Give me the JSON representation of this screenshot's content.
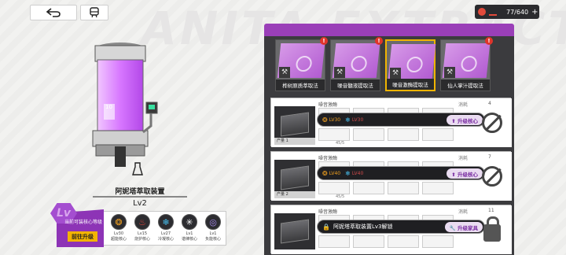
{
  "top_bar": {
    "back_icon": "back-arrow-icon",
    "device_icon": "train-icon",
    "resource_value": "77/640",
    "resource_plus": "+"
  },
  "background": {
    "title": "ANITA EXTRACT"
  },
  "device": {
    "name": "阿妮塔萃取装置",
    "level": "Lv2",
    "badge_text": "10"
  },
  "core_panel": {
    "title": "当前可装核心等级",
    "lv_badge": "Lv",
    "go_button": "前往升级",
    "cores": [
      {
        "icon": "sun-icon",
        "glyph": "❂",
        "level": "Lv30",
        "name": "超能核心",
        "color": "#f0a020"
      },
      {
        "icon": "fire-icon",
        "glyph": "♨",
        "level": "Lv15",
        "name": "烧护核心",
        "color": "#e2443a"
      },
      {
        "icon": "snowflake-icon",
        "glyph": "❄",
        "level": "Lv27",
        "name": "冷凝核心",
        "color": "#48c0f0"
      },
      {
        "icon": "sparkle-icon",
        "glyph": "✳",
        "level": "Lv1",
        "name": "谐律核心",
        "color": "#ffffff"
      },
      {
        "icon": "vortex-icon",
        "glyph": "◎",
        "level": "Lv1",
        "name": "负能核心",
        "color": "#a78af0"
      }
    ]
  },
  "recipes": [
    {
      "label": "桦树原质萃取法",
      "alert": "!",
      "selected": false
    },
    {
      "label": "噪音髓液提取法",
      "alert": "!",
      "selected": false
    },
    {
      "label": "噪音激酶提取法",
      "alert": "",
      "selected": true
    },
    {
      "label": "仙人掌汁提取法",
      "alert": "!",
      "selected": false
    }
  ],
  "slots": [
    {
      "title": "噪音激酶",
      "consume_label": "消耗",
      "consume_value": "4",
      "counter": "产量 1",
      "progress": "45/5",
      "req_left": "LV30",
      "req_right": "LV30",
      "upgrade_label": "升级核心",
      "icon": "no-entry-icon"
    },
    {
      "title": "噪音激酶",
      "consume_label": "消耗",
      "consume_value": "7",
      "counter": "产量 2",
      "progress": "45/5",
      "req_left": "LV40",
      "req_right": "LV40",
      "upgrade_label": "升级核心",
      "icon": "no-entry-icon"
    },
    {
      "title": "噪音激酶",
      "consume_label": "消耗",
      "consume_value": "11",
      "counter": "",
      "progress": "",
      "lock_text": "阿妮塔萃取装置Lv3解锁",
      "upgrade_label": "升级家具",
      "icon": "lock-icon"
    }
  ]
}
